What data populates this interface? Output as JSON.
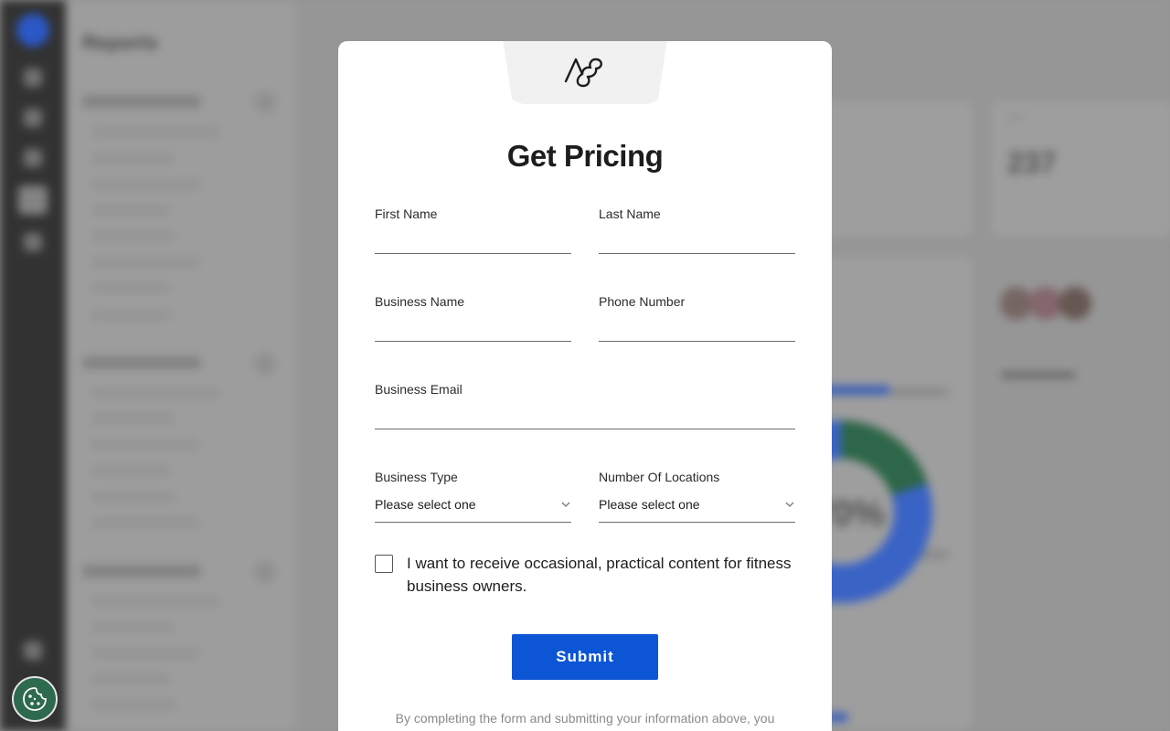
{
  "background": {
    "page_title": "Reports",
    "stat_value": "237",
    "donut_percent": "70%"
  },
  "modal": {
    "logo_icon": "brand-logo-icon",
    "title": "Get Pricing",
    "fields": {
      "first_name": {
        "label": "First Name",
        "value": ""
      },
      "last_name": {
        "label": "Last Name",
        "value": ""
      },
      "business_name": {
        "label": "Business Name",
        "value": ""
      },
      "phone_number": {
        "label": "Phone Number",
        "value": ""
      },
      "business_email": {
        "label": "Business Email",
        "value": ""
      },
      "business_type": {
        "label": "Business Type",
        "selected": "Please select one"
      },
      "number_of_locations": {
        "label": "Number Of Locations",
        "selected": "Please select one"
      }
    },
    "consent_text": "I want to receive occasional, practical content for fitness business owners.",
    "consent_checked": false,
    "submit_label": "Submit",
    "legal_text": "By completing the form and submitting your information above, you"
  },
  "cookie_button": {
    "icon": "cookie-icon"
  },
  "colors": {
    "primary": "#0c55d4",
    "cookie_bg": "#2e6a4e"
  }
}
